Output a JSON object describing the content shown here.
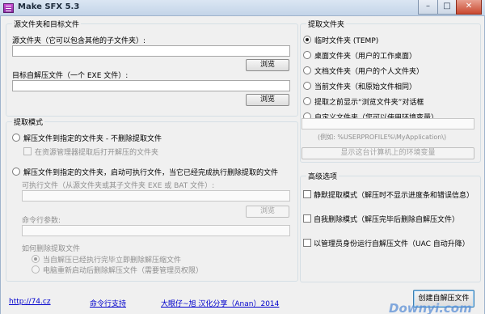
{
  "window": {
    "title": "Make SFX 5.3",
    "controls": [
      "minimize",
      "maximize",
      "close"
    ]
  },
  "source_group": {
    "legend": "源文件夹和目标文件",
    "source_label": "源文件夹（它可以包含其他的子文件夹）:",
    "source_value": "",
    "browse1": "浏览",
    "target_label": "目标自解压文件（一个 EXE 文件）:",
    "target_value": "",
    "browse2": "浏览"
  },
  "extract_mode": {
    "legend": "提取模式",
    "option1": "解压文件到指定的文件夹 - 不删除提取文件",
    "option1_check": "在资源管理器提取后打开解压的文件夹",
    "option2": "解压文件到指定的文件夹，启动可执行文件，当它已经完成执行删除提取的文件",
    "exe_label": "可执行文件（从源文件夹或其子文件夹 EXE 或 BAT 文件）:",
    "exe_value": "",
    "browse3": "浏览",
    "args_label": "命令行参数:",
    "args_value": "",
    "delete_label": "如何删除提取文件",
    "delete_opt1": "当自解压已经执行完毕立即删除解压缩文件",
    "delete_opt2": "电脑重新启动后删除解压文件（需要管理员权限）"
  },
  "extract_folder": {
    "legend": "提取文件夹",
    "options": [
      {
        "label": "临时文件夹 (TEMP)",
        "selected": true
      },
      {
        "label": "桌面文件夹（用户的工作桌面）",
        "selected": false
      },
      {
        "label": "文档文件夹（用户的个人文件夹）",
        "selected": false
      },
      {
        "label": "当前文件夹（和原始文件相同）",
        "selected": false
      },
      {
        "label": "提取之前显示“浏览文件夹”对话框",
        "selected": false
      },
      {
        "label": "自定义文件夹（您可以使用环境变量）",
        "selected": false
      }
    ],
    "custom_value": "",
    "example": "(例如: %USERPROFILE%\\MyApplication\\)",
    "env_button": "显示这台计算机上的环境变量"
  },
  "advanced": {
    "legend": "高级选项",
    "options": [
      "静默提取模式（解压时不显示进度条和错误信息）",
      "自我删除模式（解压完毕后删除自解压文件）",
      "以管理员身份运行自解压文件（UAC 自动升降）"
    ]
  },
  "footer": {
    "link1": "http://74.cz",
    "link2": "命令行支持",
    "link3": "大眼仔~旭 汉化分享（Anan）2014",
    "create_button": "创建自解压文件"
  },
  "watermark": "Downyi.com",
  "colors": {
    "titlebar": "#c3d4e8",
    "client": "#f0f0f0",
    "link": "#0000cc",
    "close": "#c9482f"
  }
}
